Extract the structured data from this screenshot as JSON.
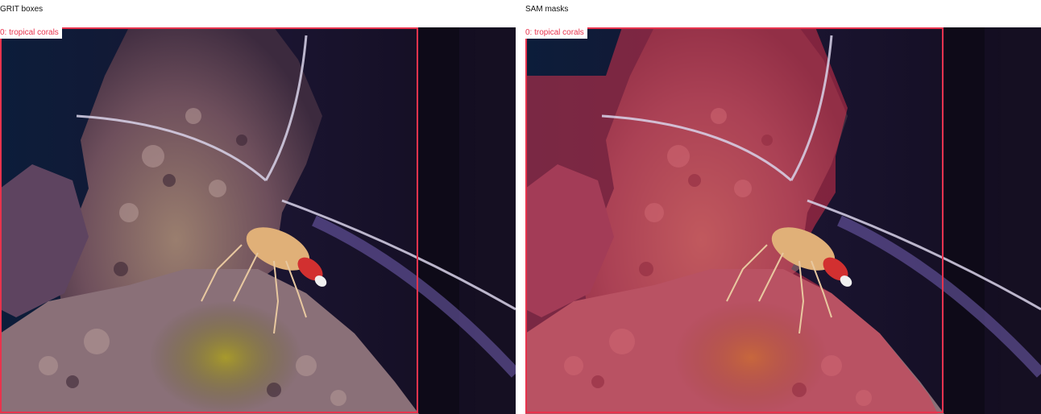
{
  "panels": [
    {
      "title": "GRIT boxes",
      "box_label": "0: tropical corals",
      "box_color": "#e8334d",
      "image_description_icon": "coral-reef-shrimp-photo"
    },
    {
      "title": "SAM masks",
      "box_label": "0: tropical corals",
      "box_color": "#e8334d",
      "mask_color": "#e8334d",
      "image_description_icon": "coral-reef-shrimp-photo"
    }
  ]
}
